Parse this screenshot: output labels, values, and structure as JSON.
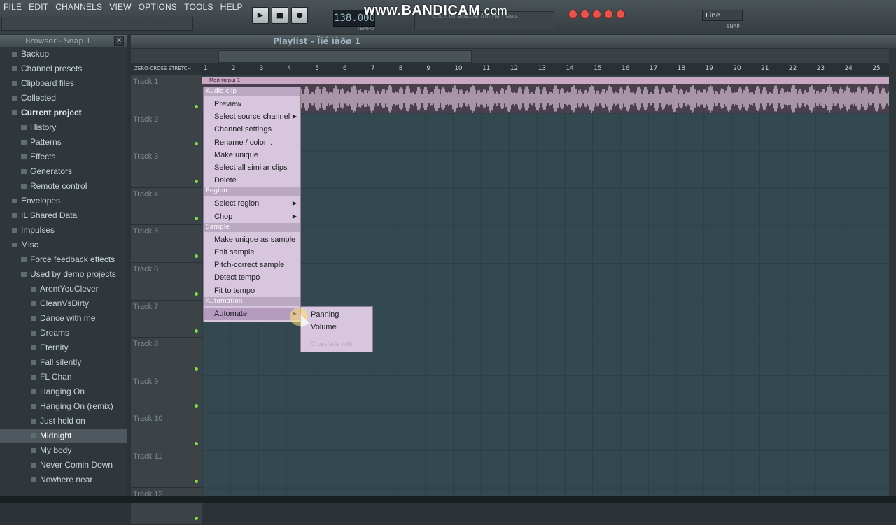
{
  "menu": [
    "FILE",
    "EDIT",
    "CHANNELS",
    "VIEW",
    "OPTIONS",
    "TOOLS",
    "HELP"
  ],
  "watermark": {
    "main": "www.BANDICAM",
    "suffix": ".com"
  },
  "transport": {
    "play": "▶",
    "stop": "■",
    "record": "●",
    "tempo_value": "138.000",
    "tempo_label": "TEMPO"
  },
  "news": {
    "text": "Click to enable online news"
  },
  "snap": {
    "value": "Line",
    "label": "SNAP"
  },
  "browser": {
    "title": "Browser - Snap 1",
    "items": [
      {
        "label": "Backup",
        "level": 0,
        "bold": false
      },
      {
        "label": "Channel presets",
        "level": 0,
        "bold": false
      },
      {
        "label": "Clipboard files",
        "level": 0,
        "bold": false
      },
      {
        "label": "Collected",
        "level": 0,
        "bold": false
      },
      {
        "label": "Current project",
        "level": 0,
        "bold": true
      },
      {
        "label": "History",
        "level": 1,
        "bold": false
      },
      {
        "label": "Patterns",
        "level": 1,
        "bold": false
      },
      {
        "label": "Effects",
        "level": 1,
        "bold": false
      },
      {
        "label": "Generators",
        "level": 1,
        "bold": false
      },
      {
        "label": "Remote control",
        "level": 1,
        "bold": false
      },
      {
        "label": "Envelopes",
        "level": 0,
        "bold": false
      },
      {
        "label": "IL Shared Data",
        "level": 0,
        "bold": false
      },
      {
        "label": "Impulses",
        "level": 0,
        "bold": false
      },
      {
        "label": "Misc",
        "level": 0,
        "bold": false
      },
      {
        "label": "Force feedback effects",
        "level": 1,
        "bold": false
      },
      {
        "label": "Used by demo projects",
        "level": 1,
        "bold": false
      },
      {
        "label": "ArentYouClever",
        "level": 2,
        "bold": false
      },
      {
        "label": "CleanVsDirty",
        "level": 2,
        "bold": false
      },
      {
        "label": "Dance with me",
        "level": 2,
        "bold": false
      },
      {
        "label": "Dreams",
        "level": 2,
        "bold": false
      },
      {
        "label": "Eternity",
        "level": 2,
        "bold": false
      },
      {
        "label": "Fall silently",
        "level": 2,
        "bold": false
      },
      {
        "label": "FL Chan",
        "level": 2,
        "bold": false
      },
      {
        "label": "Hanging On",
        "level": 2,
        "bold": false
      },
      {
        "label": "Hanging On (remix)",
        "level": 2,
        "bold": false
      },
      {
        "label": "Just hold on",
        "level": 2,
        "bold": false
      },
      {
        "label": "Midnight",
        "level": 2,
        "bold": false,
        "selected": true
      },
      {
        "label": "My body",
        "level": 2,
        "bold": false
      },
      {
        "label": "Never Comin Down",
        "level": 2,
        "bold": false
      },
      {
        "label": "Nowhere near",
        "level": 2,
        "bold": false
      }
    ]
  },
  "playlist": {
    "title": "Playlist - Ïîé ìàðø 1",
    "options": "ZERO-CROSS  STRETCH",
    "ruler": [
      "1",
      "2",
      "3",
      "4",
      "5",
      "6",
      "7",
      "8",
      "9",
      "10",
      "11",
      "12",
      "13",
      "14",
      "15",
      "16",
      "17",
      "18",
      "19",
      "20",
      "21",
      "22",
      "23",
      "24",
      "25"
    ],
    "tracks": [
      "Track 1",
      "Track 2",
      "Track 3",
      "Track 4",
      "Track 5",
      "Track 6",
      "Track 7",
      "Track 8",
      "Track 9",
      "Track 10",
      "Track 11",
      "Track 12"
    ],
    "clip_name": "Мой марш 1"
  },
  "context_menu": {
    "sections": [
      {
        "header": "Audio clip",
        "items": [
          {
            "label": "Preview"
          },
          {
            "label": "Select source channel",
            "submenu": true
          },
          {
            "label": "Channel settings"
          },
          {
            "label": "Rename / color..."
          },
          {
            "label": "Make unique"
          },
          {
            "label": "Select all similar clips"
          },
          {
            "label": "Delete"
          }
        ]
      },
      {
        "header": "Region",
        "items": [
          {
            "label": "Select region",
            "submenu": true
          },
          {
            "label": "Chop",
            "submenu": true
          }
        ]
      },
      {
        "header": "Sample",
        "items": [
          {
            "label": "Make unique as sample"
          },
          {
            "label": "Edit sample"
          },
          {
            "label": "Pitch-correct sample"
          },
          {
            "label": "Detect tempo"
          },
          {
            "label": "Fit to tempo"
          }
        ]
      },
      {
        "header": "Automation",
        "items": [
          {
            "label": "Automate",
            "submenu": true,
            "highlighted": true
          }
        ]
      }
    ],
    "submenu": [
      {
        "label": "Panning",
        "disabled": false
      },
      {
        "label": "Volume",
        "disabled": false
      },
      {
        "label": "Crossfade with",
        "disabled": true
      }
    ]
  }
}
